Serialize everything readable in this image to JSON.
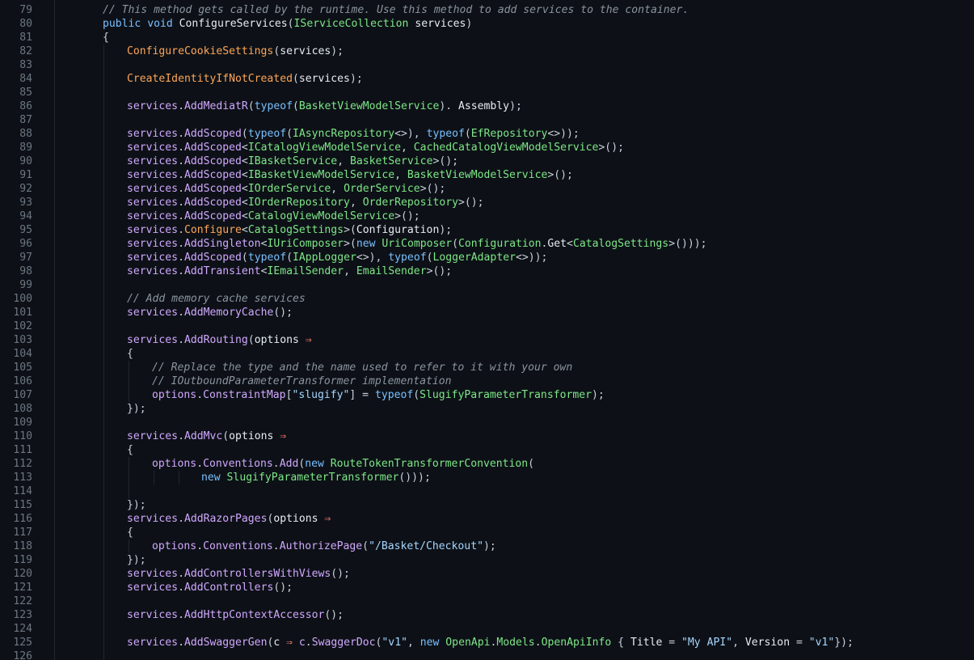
{
  "editor": {
    "language": "csharp",
    "theme_colors": {
      "background": "#0d1117",
      "line_number": "#6e7681",
      "text": "#c9d1d9",
      "keyword": "#79c0ff",
      "type": "#7ee787",
      "method": "#d2a8ff",
      "comment": "#8b949e",
      "string": "#a5d6ff",
      "operator": "#ff7b72"
    },
    "first_line_number": 79,
    "lines": [
      {
        "n": "79",
        "indent": 1,
        "tokens": [
          [
            "c",
            "// This method gets called by the runtime. Use this method to add services to the container."
          ]
        ]
      },
      {
        "n": "80",
        "indent": 1,
        "tokens": [
          [
            "k",
            "public"
          ],
          [
            "p",
            " "
          ],
          [
            "k",
            "void"
          ],
          [
            "p",
            " "
          ],
          [
            "ent",
            "ConfigureServices"
          ],
          [
            "p",
            "("
          ],
          [
            "t",
            "IServiceCollection"
          ],
          [
            "p",
            " "
          ],
          [
            "ent",
            "services"
          ],
          [
            "p",
            ")"
          ]
        ]
      },
      {
        "n": "81",
        "indent": 1,
        "tokens": [
          [
            "p",
            "{"
          ]
        ]
      },
      {
        "n": "82",
        "indent": 2,
        "tokens": [
          [
            "nm",
            "ConfigureCookieSettings"
          ],
          [
            "p",
            "("
          ],
          [
            "ent",
            "services"
          ],
          [
            "p",
            ");"
          ]
        ]
      },
      {
        "n": "83",
        "indent": 2,
        "tokens": []
      },
      {
        "n": "84",
        "indent": 2,
        "tokens": [
          [
            "nm",
            "CreateIdentityIfNotCreated"
          ],
          [
            "p",
            "("
          ],
          [
            "ent",
            "services"
          ],
          [
            "p",
            ");"
          ]
        ]
      },
      {
        "n": "85",
        "indent": 2,
        "tokens": []
      },
      {
        "n": "86",
        "indent": 2,
        "tokens": [
          [
            "v",
            "services"
          ],
          [
            "p",
            "."
          ],
          [
            "f",
            "AddMediatR"
          ],
          [
            "p",
            "("
          ],
          [
            "k",
            "typeof"
          ],
          [
            "p",
            "("
          ],
          [
            "t",
            "BasketViewModelService"
          ],
          [
            "p",
            "). "
          ],
          [
            "ent",
            "Assembly"
          ],
          [
            "p",
            ");"
          ]
        ]
      },
      {
        "n": "87",
        "indent": 2,
        "tokens": []
      },
      {
        "n": "88",
        "indent": 2,
        "tokens": [
          [
            "v",
            "services"
          ],
          [
            "p",
            "."
          ],
          [
            "f",
            "AddScoped"
          ],
          [
            "p",
            "("
          ],
          [
            "k",
            "typeof"
          ],
          [
            "p",
            "("
          ],
          [
            "t",
            "IAsyncRepository"
          ],
          [
            "p",
            "<>), "
          ],
          [
            "k",
            "typeof"
          ],
          [
            "p",
            "("
          ],
          [
            "t",
            "EfRepository"
          ],
          [
            "p",
            "<>));"
          ]
        ]
      },
      {
        "n": "89",
        "indent": 2,
        "tokens": [
          [
            "v",
            "services"
          ],
          [
            "p",
            "."
          ],
          [
            "f",
            "AddScoped"
          ],
          [
            "p",
            "<"
          ],
          [
            "t",
            "ICatalogViewModelService"
          ],
          [
            "p",
            ", "
          ],
          [
            "t",
            "CachedCatalogViewModelService"
          ],
          [
            "p",
            ">();"
          ]
        ]
      },
      {
        "n": "90",
        "indent": 2,
        "tokens": [
          [
            "v",
            "services"
          ],
          [
            "p",
            "."
          ],
          [
            "f",
            "AddScoped"
          ],
          [
            "p",
            "<"
          ],
          [
            "t",
            "IBasketService"
          ],
          [
            "p",
            ", "
          ],
          [
            "t",
            "BasketService"
          ],
          [
            "p",
            ">();"
          ]
        ]
      },
      {
        "n": "91",
        "indent": 2,
        "tokens": [
          [
            "v",
            "services"
          ],
          [
            "p",
            "."
          ],
          [
            "f",
            "AddScoped"
          ],
          [
            "p",
            "<"
          ],
          [
            "t",
            "IBasketViewModelService"
          ],
          [
            "p",
            ", "
          ],
          [
            "t",
            "BasketViewModelService"
          ],
          [
            "p",
            ">();"
          ]
        ]
      },
      {
        "n": "92",
        "indent": 2,
        "tokens": [
          [
            "v",
            "services"
          ],
          [
            "p",
            "."
          ],
          [
            "f",
            "AddScoped"
          ],
          [
            "p",
            "<"
          ],
          [
            "t",
            "IOrderService"
          ],
          [
            "p",
            ", "
          ],
          [
            "t",
            "OrderService"
          ],
          [
            "p",
            ">();"
          ]
        ]
      },
      {
        "n": "93",
        "indent": 2,
        "tokens": [
          [
            "v",
            "services"
          ],
          [
            "p",
            "."
          ],
          [
            "f",
            "AddScoped"
          ],
          [
            "p",
            "<"
          ],
          [
            "t",
            "IOrderRepository"
          ],
          [
            "p",
            ", "
          ],
          [
            "t",
            "OrderRepository"
          ],
          [
            "p",
            ">();"
          ]
        ]
      },
      {
        "n": "94",
        "indent": 2,
        "tokens": [
          [
            "v",
            "services"
          ],
          [
            "p",
            "."
          ],
          [
            "f",
            "AddScoped"
          ],
          [
            "p",
            "<"
          ],
          [
            "t",
            "CatalogViewModelService"
          ],
          [
            "p",
            ">();"
          ]
        ]
      },
      {
        "n": "95",
        "indent": 2,
        "tokens": [
          [
            "v",
            "services"
          ],
          [
            "p",
            "."
          ],
          [
            "nm",
            "Configure"
          ],
          [
            "p",
            "<"
          ],
          [
            "t",
            "CatalogSettings"
          ],
          [
            "p",
            ">("
          ],
          [
            "ent",
            "Configuration"
          ],
          [
            "p",
            ");"
          ]
        ]
      },
      {
        "n": "96",
        "indent": 2,
        "tokens": [
          [
            "v",
            "services"
          ],
          [
            "p",
            "."
          ],
          [
            "f",
            "AddSingleton"
          ],
          [
            "p",
            "<"
          ],
          [
            "t",
            "IUriComposer"
          ],
          [
            "p",
            ">("
          ],
          [
            "k",
            "new"
          ],
          [
            "p",
            " "
          ],
          [
            "t",
            "UriComposer"
          ],
          [
            "p",
            "("
          ],
          [
            "t",
            "Configuration"
          ],
          [
            "p",
            "."
          ],
          [
            "ent",
            "Get"
          ],
          [
            "p",
            "<"
          ],
          [
            "t",
            "CatalogSettings"
          ],
          [
            "p",
            ">()));"
          ]
        ]
      },
      {
        "n": "97",
        "indent": 2,
        "tokens": [
          [
            "v",
            "services"
          ],
          [
            "p",
            "."
          ],
          [
            "f",
            "AddScoped"
          ],
          [
            "p",
            "("
          ],
          [
            "k",
            "typeof"
          ],
          [
            "p",
            "("
          ],
          [
            "t",
            "IAppLogger"
          ],
          [
            "p",
            "<>), "
          ],
          [
            "k",
            "typeof"
          ],
          [
            "p",
            "("
          ],
          [
            "t",
            "LoggerAdapter"
          ],
          [
            "p",
            "<>));"
          ]
        ]
      },
      {
        "n": "98",
        "indent": 2,
        "tokens": [
          [
            "v",
            "services"
          ],
          [
            "p",
            "."
          ],
          [
            "f",
            "AddTransient"
          ],
          [
            "p",
            "<"
          ],
          [
            "t",
            "IEmailSender"
          ],
          [
            "p",
            ", "
          ],
          [
            "t",
            "EmailSender"
          ],
          [
            "p",
            ">();"
          ]
        ]
      },
      {
        "n": "99",
        "indent": 2,
        "tokens": []
      },
      {
        "n": "100",
        "indent": 2,
        "tokens": [
          [
            "c",
            "// Add memory cache services"
          ]
        ]
      },
      {
        "n": "101",
        "indent": 2,
        "tokens": [
          [
            "v",
            "services"
          ],
          [
            "p",
            "."
          ],
          [
            "f",
            "AddMemoryCache"
          ],
          [
            "p",
            "();"
          ]
        ]
      },
      {
        "n": "102",
        "indent": 2,
        "tokens": []
      },
      {
        "n": "103",
        "indent": 2,
        "tokens": [
          [
            "v",
            "services"
          ],
          [
            "p",
            "."
          ],
          [
            "f",
            "AddRouting"
          ],
          [
            "p",
            "("
          ],
          [
            "ent",
            "options"
          ],
          [
            "p",
            " "
          ],
          [
            "o",
            "⇒"
          ]
        ]
      },
      {
        "n": "104",
        "indent": 2,
        "tokens": [
          [
            "p",
            "{"
          ]
        ]
      },
      {
        "n": "105",
        "indent": 3,
        "tokens": [
          [
            "c",
            "// Replace the type and the name used to refer to it with your own"
          ]
        ]
      },
      {
        "n": "106",
        "indent": 3,
        "tokens": [
          [
            "c",
            "// IOutboundParameterTransformer implementation"
          ]
        ]
      },
      {
        "n": "107",
        "indent": 3,
        "tokens": [
          [
            "v",
            "options"
          ],
          [
            "p",
            "."
          ],
          [
            "f",
            "ConstraintMap"
          ],
          [
            "p",
            "["
          ],
          [
            "s",
            "\"slugify\""
          ],
          [
            "p",
            "] = "
          ],
          [
            "k",
            "typeof"
          ],
          [
            "p",
            "("
          ],
          [
            "t",
            "SlugifyParameterTransformer"
          ],
          [
            "p",
            ");"
          ]
        ]
      },
      {
        "n": "108",
        "indent": 2,
        "tokens": [
          [
            "p",
            "});"
          ]
        ]
      },
      {
        "n": "109",
        "indent": 2,
        "tokens": []
      },
      {
        "n": "110",
        "indent": 2,
        "tokens": [
          [
            "v",
            "services"
          ],
          [
            "p",
            "."
          ],
          [
            "f",
            "AddMvc"
          ],
          [
            "p",
            "("
          ],
          [
            "ent",
            "options"
          ],
          [
            "p",
            " "
          ],
          [
            "o",
            "⇒"
          ]
        ]
      },
      {
        "n": "111",
        "indent": 2,
        "tokens": [
          [
            "p",
            "{"
          ]
        ]
      },
      {
        "n": "112",
        "indent": 3,
        "tokens": [
          [
            "v",
            "options"
          ],
          [
            "p",
            "."
          ],
          [
            "f",
            "Conventions"
          ],
          [
            "p",
            "."
          ],
          [
            "f",
            "Add"
          ],
          [
            "p",
            "("
          ],
          [
            "k",
            "new"
          ],
          [
            "p",
            " "
          ],
          [
            "t",
            "RouteTokenTransformerConvention"
          ],
          [
            "p",
            "("
          ]
        ]
      },
      {
        "n": "113",
        "indent": 5,
        "tokens": [
          [
            "k",
            "new"
          ],
          [
            "p",
            " "
          ],
          [
            "t",
            "SlugifyParameterTransformer"
          ],
          [
            "p",
            "()));"
          ]
        ]
      },
      {
        "n": "114",
        "indent": 2,
        "tokens": []
      },
      {
        "n": "115",
        "indent": 2,
        "tokens": [
          [
            "p",
            "});"
          ]
        ]
      },
      {
        "n": "116",
        "indent": 2,
        "tokens": [
          [
            "v",
            "services"
          ],
          [
            "p",
            "."
          ],
          [
            "f",
            "AddRazorPages"
          ],
          [
            "p",
            "("
          ],
          [
            "ent",
            "options"
          ],
          [
            "p",
            " "
          ],
          [
            "o",
            "⇒"
          ]
        ]
      },
      {
        "n": "117",
        "indent": 2,
        "tokens": [
          [
            "p",
            "{"
          ]
        ]
      },
      {
        "n": "118",
        "indent": 3,
        "tokens": [
          [
            "v",
            "options"
          ],
          [
            "p",
            "."
          ],
          [
            "f",
            "Conventions"
          ],
          [
            "p",
            "."
          ],
          [
            "f",
            "AuthorizePage"
          ],
          [
            "p",
            "("
          ],
          [
            "s",
            "\"/Basket/Checkout\""
          ],
          [
            "p",
            ");"
          ]
        ]
      },
      {
        "n": "119",
        "indent": 2,
        "tokens": [
          [
            "p",
            "});"
          ]
        ]
      },
      {
        "n": "120",
        "indent": 2,
        "tokens": [
          [
            "v",
            "services"
          ],
          [
            "p",
            "."
          ],
          [
            "f",
            "AddControllersWithViews"
          ],
          [
            "p",
            "();"
          ]
        ]
      },
      {
        "n": "121",
        "indent": 2,
        "tokens": [
          [
            "v",
            "services"
          ],
          [
            "p",
            "."
          ],
          [
            "f",
            "AddControllers"
          ],
          [
            "p",
            "();"
          ]
        ]
      },
      {
        "n": "122",
        "indent": 2,
        "tokens": []
      },
      {
        "n": "123",
        "indent": 2,
        "tokens": [
          [
            "v",
            "services"
          ],
          [
            "p",
            "."
          ],
          [
            "f",
            "AddHttpContextAccessor"
          ],
          [
            "p",
            "();"
          ]
        ]
      },
      {
        "n": "124",
        "indent": 2,
        "tokens": []
      },
      {
        "n": "125",
        "indent": 2,
        "tokens": [
          [
            "v",
            "services"
          ],
          [
            "p",
            "."
          ],
          [
            "f",
            "AddSwaggerGen"
          ],
          [
            "p",
            "("
          ],
          [
            "ent",
            "c"
          ],
          [
            "p",
            " "
          ],
          [
            "o",
            "⇒"
          ],
          [
            "p",
            " "
          ],
          [
            "v",
            "c"
          ],
          [
            "p",
            "."
          ],
          [
            "f",
            "SwaggerDoc"
          ],
          [
            "p",
            "("
          ],
          [
            "s",
            "\"v1\""
          ],
          [
            "p",
            ", "
          ],
          [
            "k",
            "new"
          ],
          [
            "p",
            " "
          ],
          [
            "t",
            "OpenApi"
          ],
          [
            "p",
            "."
          ],
          [
            "t",
            "Models"
          ],
          [
            "p",
            "."
          ],
          [
            "t",
            "OpenApiInfo"
          ],
          [
            "p",
            " { "
          ],
          [
            "ent",
            "Title"
          ],
          [
            "p",
            " = "
          ],
          [
            "s",
            "\"My API\""
          ],
          [
            "p",
            ", "
          ],
          [
            "ent",
            "Version"
          ],
          [
            "p",
            " = "
          ],
          [
            "s",
            "\"v1\""
          ],
          [
            "p",
            "});"
          ]
        ]
      },
      {
        "n": "126",
        "indent": 1,
        "tokens": []
      }
    ]
  }
}
